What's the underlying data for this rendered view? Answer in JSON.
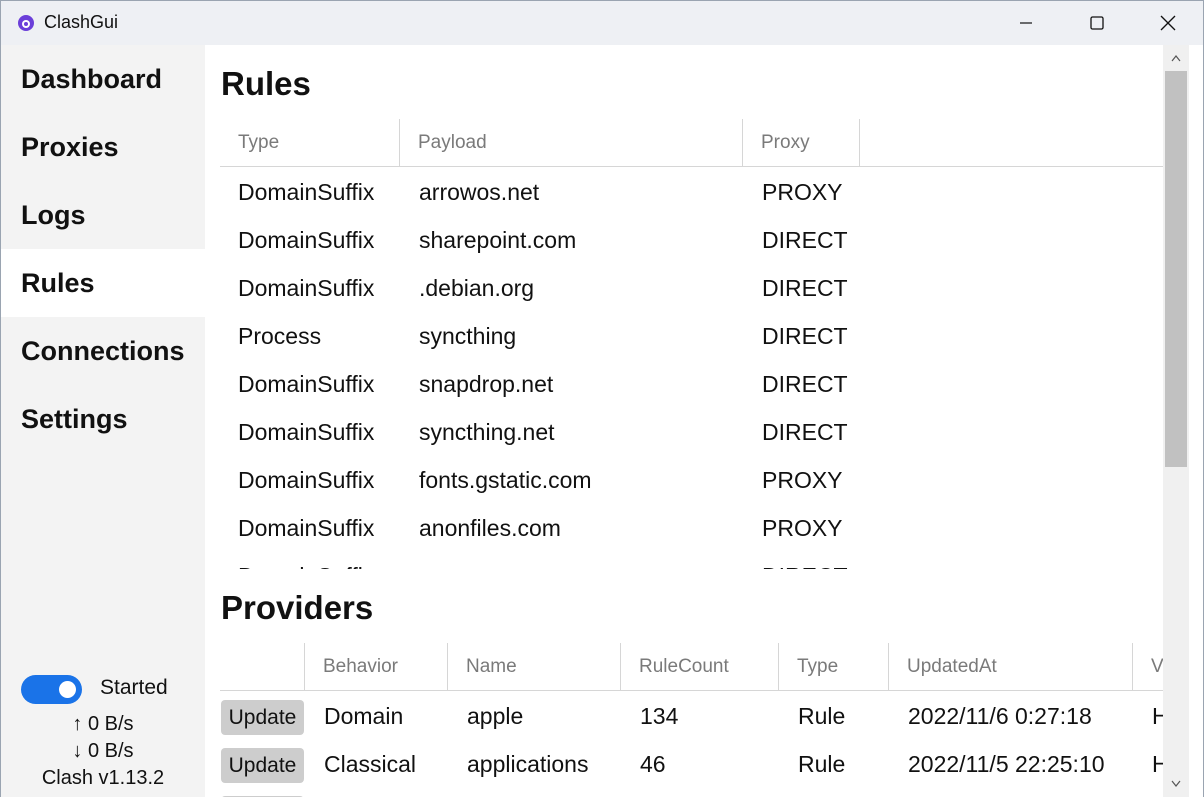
{
  "window": {
    "title": "ClashGui"
  },
  "nav": {
    "items": [
      {
        "label": "Dashboard"
      },
      {
        "label": "Proxies"
      },
      {
        "label": "Logs"
      },
      {
        "label": "Rules"
      },
      {
        "label": "Connections"
      },
      {
        "label": "Settings"
      }
    ],
    "active": "Rules"
  },
  "status": {
    "state": "Started",
    "upload": "↑ 0 B/s",
    "download": "↓ 0 B/s",
    "version": "Clash v1.13.2"
  },
  "rules": {
    "title": "Rules",
    "columns": [
      "Type",
      "Payload",
      "Proxy"
    ],
    "rows": [
      [
        "DomainSuffix",
        "arrowos.net",
        "PROXY"
      ],
      [
        "DomainSuffix",
        "sharepoint.com",
        "DIRECT"
      ],
      [
        "DomainSuffix",
        ".debian.org",
        "DIRECT"
      ],
      [
        "Process",
        "syncthing",
        "DIRECT"
      ],
      [
        "DomainSuffix",
        "snapdrop.net",
        "DIRECT"
      ],
      [
        "DomainSuffix",
        "syncthing.net",
        "DIRECT"
      ],
      [
        "DomainSuffix",
        "fonts.gstatic.com",
        "PROXY"
      ],
      [
        "DomainSuffix",
        "anonfiles.com",
        "PROXY"
      ],
      [
        "DomainSuffix",
        "",
        "DIRECT"
      ]
    ]
  },
  "providers": {
    "title": "Providers",
    "columns": [
      "",
      "Behavior",
      "Name",
      "RuleCount",
      "Type",
      "UpdatedAt",
      "Vehi"
    ],
    "update_label": "Update",
    "rows": [
      [
        "Domain",
        "apple",
        "134",
        "Rule",
        "2022/11/6 0:27:18",
        "HTT"
      ],
      [
        "Classical",
        "applications",
        "46",
        "Rule",
        "2022/11/5 22:25:10",
        "HTT"
      ]
    ]
  },
  "colors": {
    "accent": "#1a73e8",
    "active_nav": "#ffffff",
    "sidebar": "#f3f3f3"
  }
}
